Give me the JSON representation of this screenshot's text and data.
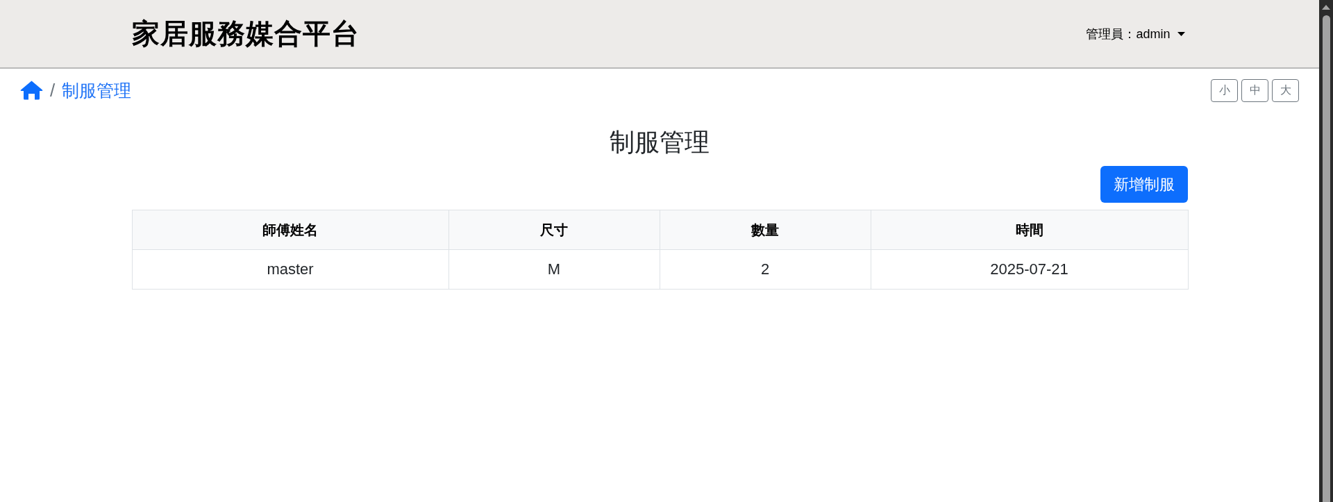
{
  "header": {
    "title": "家居服務媒合平台",
    "user_menu": "管理員：admin"
  },
  "breadcrumb": {
    "separator": "/",
    "current": "制服管理"
  },
  "font_size_buttons": [
    {
      "label": "小"
    },
    {
      "label": "中"
    },
    {
      "label": "大"
    }
  ],
  "page_title": "制服管理",
  "add_button": "新增制服",
  "table": {
    "columns": [
      "師傅姓名",
      "尺寸",
      "數量",
      "時間"
    ],
    "rows": [
      [
        "master",
        "M",
        "2",
        "2025-07-21"
      ]
    ]
  }
}
